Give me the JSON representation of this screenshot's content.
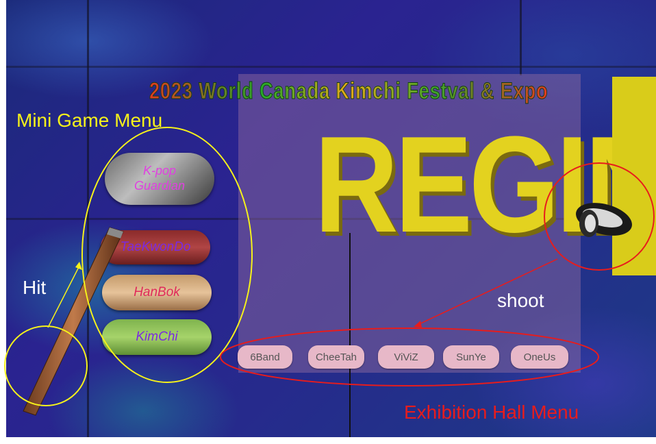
{
  "scene": {
    "banner_title": "2023 World Canada Kimchi Festval & Expo",
    "background_word": "REGIN"
  },
  "mini_game_menu": {
    "label": "Mini Game Menu",
    "items": [
      {
        "line1": "K-pop",
        "line2": "Guardian"
      },
      {
        "label": "TaeKwonDo"
      },
      {
        "label": "HanBok"
      },
      {
        "label": "KimChi"
      }
    ]
  },
  "exhibition_hall_menu": {
    "label": "Exhibition Hall Menu",
    "buttons": [
      "6Band",
      "CheeTah",
      "ViViZ",
      "SunYe",
      "OneUs"
    ]
  },
  "annotations": {
    "hit": "Hit",
    "shoot": "shoot",
    "colors": {
      "mini_game": "#f6f21a",
      "exhibition": "#e81c1c",
      "hit": "#ffffff"
    }
  }
}
